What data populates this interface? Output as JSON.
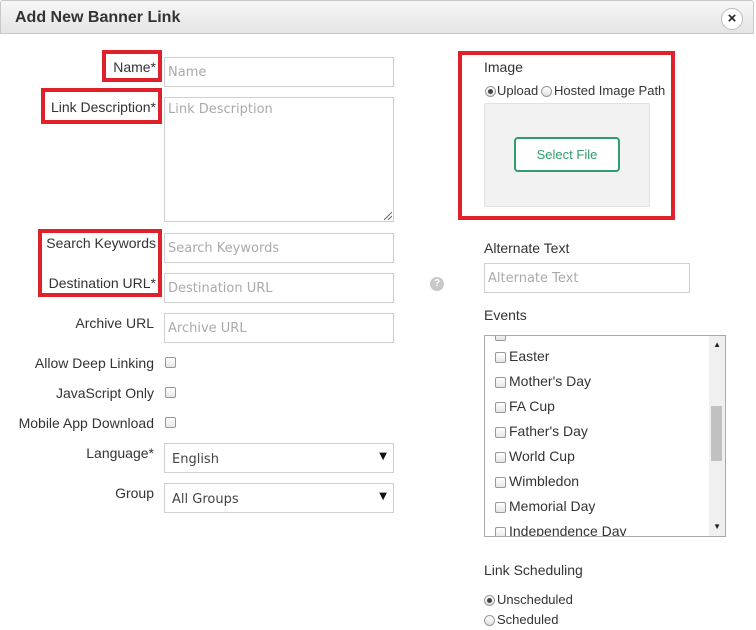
{
  "dialog": {
    "title": "Add New Banner Link",
    "close_label": "×"
  },
  "left": {
    "name_label": "Name*",
    "name_placeholder": "Name",
    "description_label": "Link Description*",
    "description_placeholder": "Link Description",
    "keywords_label": "Search Keywords",
    "keywords_placeholder": "Search Keywords",
    "destination_label": "Destination URL*",
    "destination_placeholder": "Destination URL",
    "archive_label": "Archive URL",
    "archive_placeholder": "Archive URL",
    "deep_linking_label": "Allow Deep Linking",
    "js_only_label": "JavaScript Only",
    "mobile_app_label": "Mobile App Download",
    "language_label": "Language*",
    "language_value": "English",
    "group_label": "Group",
    "group_value": "All Groups",
    "help_icon": "?"
  },
  "right": {
    "image_label": "Image",
    "upload_option": "Upload",
    "hosted_option": "Hosted Image Path",
    "selected_image_option": "Upload",
    "select_file_label": "Select File",
    "alt_text_label": "Alternate Text",
    "alt_text_placeholder": "Alternate Text",
    "events_label": "Events",
    "events": [
      "Easter",
      "Mother's Day",
      "FA Cup",
      "Father's Day",
      "World Cup",
      "Wimbledon",
      "Memorial Day",
      "Independence Day"
    ],
    "scheduling_label": "Link Scheduling",
    "unscheduled_option": "Unscheduled",
    "scheduled_option": "Scheduled",
    "selected_schedule_option": "Unscheduled"
  },
  "colors": {
    "highlight": "#e0202a",
    "button_green": "#2e9e6a"
  }
}
